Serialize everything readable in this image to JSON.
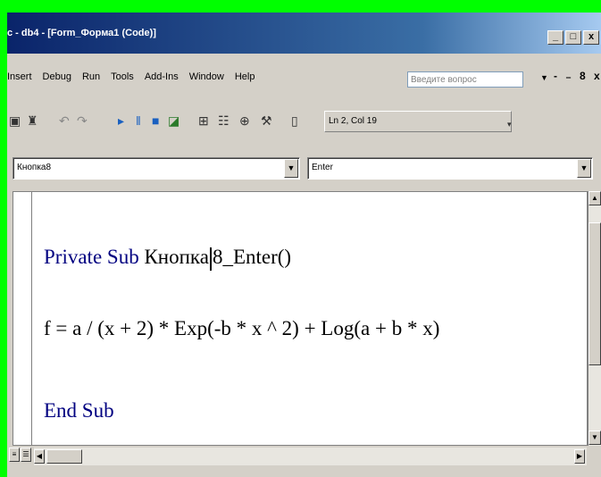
{
  "window": {
    "title": "c - db4 - [Form_Форма1 (Code)]"
  },
  "title_buttons": [
    "_",
    "□",
    "x"
  ],
  "menu": {
    "items": [
      "Insert",
      "Debug",
      "Run",
      "Tools",
      "Add-Ins",
      "Window",
      "Help"
    ],
    "ask_placeholder": "Введите вопрос",
    "mdi_buttons": "- ₋ 8 x"
  },
  "toolbar": {
    "position": "Ln 2, Col 19",
    "icons": [
      "save-icon",
      "find-icon",
      "undo-icon",
      "redo-icon",
      "run-icon",
      "break-icon",
      "reset-icon",
      "design-mode-icon",
      "project-explorer-icon",
      "properties-icon",
      "object-browser-icon",
      "toolbox-icon",
      "help-icon"
    ]
  },
  "object_combo": {
    "value": "Кнопка8"
  },
  "procedure_combo": {
    "value": "Enter"
  },
  "code": {
    "line1_kw": "Private Sub ",
    "line1_pre": "Кнопка",
    "line1_post": "8_Enter()",
    "line2": "f = a / (x + 2) * Exp(-b * x ^ 2) + Log(a + b * x)",
    "line3": "End Sub"
  },
  "colors": {
    "background": "#00ff00",
    "title_start": "#0a246a",
    "keyword": "#000080"
  }
}
